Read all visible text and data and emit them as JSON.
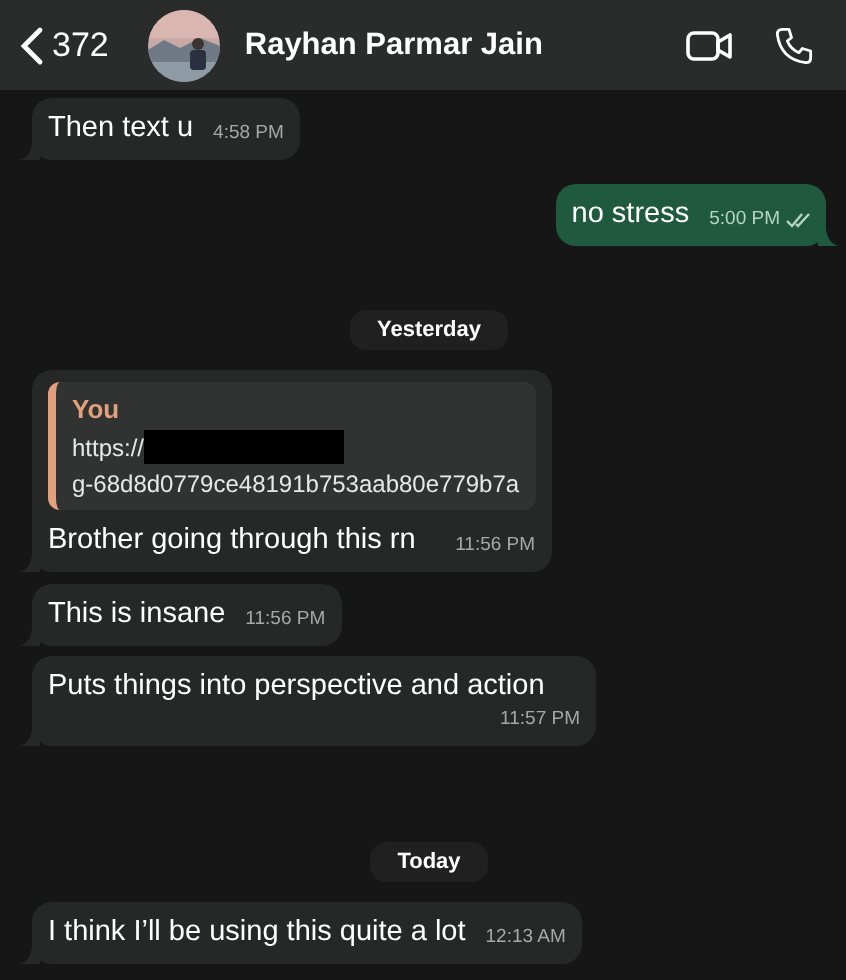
{
  "header": {
    "back_count": "372",
    "name": "Rayhan Parmar Jain"
  },
  "messages": [
    {
      "kind": "incoming",
      "text": "Then text u",
      "time": "4:58 PM"
    },
    {
      "kind": "outgoing",
      "text": "no stress",
      "time": "5:00 PM",
      "read": true
    },
    {
      "kind": "date",
      "text": "Yesterday"
    },
    {
      "kind": "incoming",
      "text": "Brother going through this rn",
      "time": "11:56 PM",
      "quote": {
        "author": "You",
        "lines": [
          "https://",
          "g-68d8d0779ce48191b753aab80e779b7a"
        ],
        "redacted": true
      }
    },
    {
      "kind": "incoming",
      "text": "This is insane",
      "time": "11:56 PM"
    },
    {
      "kind": "incoming",
      "text": "Puts things into perspective and action",
      "time": "11:57 PM"
    },
    {
      "kind": "date",
      "text": "Today"
    },
    {
      "kind": "incoming",
      "text": "I think I’ll be using this quite a lot",
      "time": "12:13 AM"
    }
  ]
}
